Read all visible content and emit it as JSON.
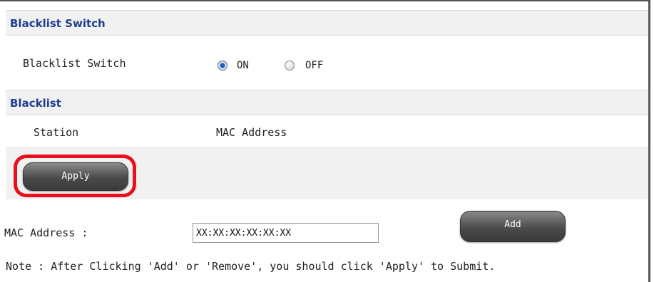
{
  "blacklist_switch_section": {
    "header": "Blacklist Switch",
    "row_label": "Blacklist Switch",
    "options": [
      {
        "label": "ON",
        "selected": true
      },
      {
        "label": "OFF",
        "selected": false
      }
    ]
  },
  "blacklist_section": {
    "header": "Blacklist",
    "columns": [
      "Station",
      "MAC Address"
    ]
  },
  "apply_button": "Apply",
  "mac_form": {
    "label": "MAC Address :",
    "value": "XX:XX:XX:XX:XX:XX",
    "add_button": "Add"
  },
  "note": "Note : After Clicking 'Add' or 'Remove', you should click 'Apply' to Submit.",
  "colors": {
    "header_text": "#1f3f8f",
    "highlight": "#e8101e",
    "selected_radio": "#1b5fb8"
  }
}
